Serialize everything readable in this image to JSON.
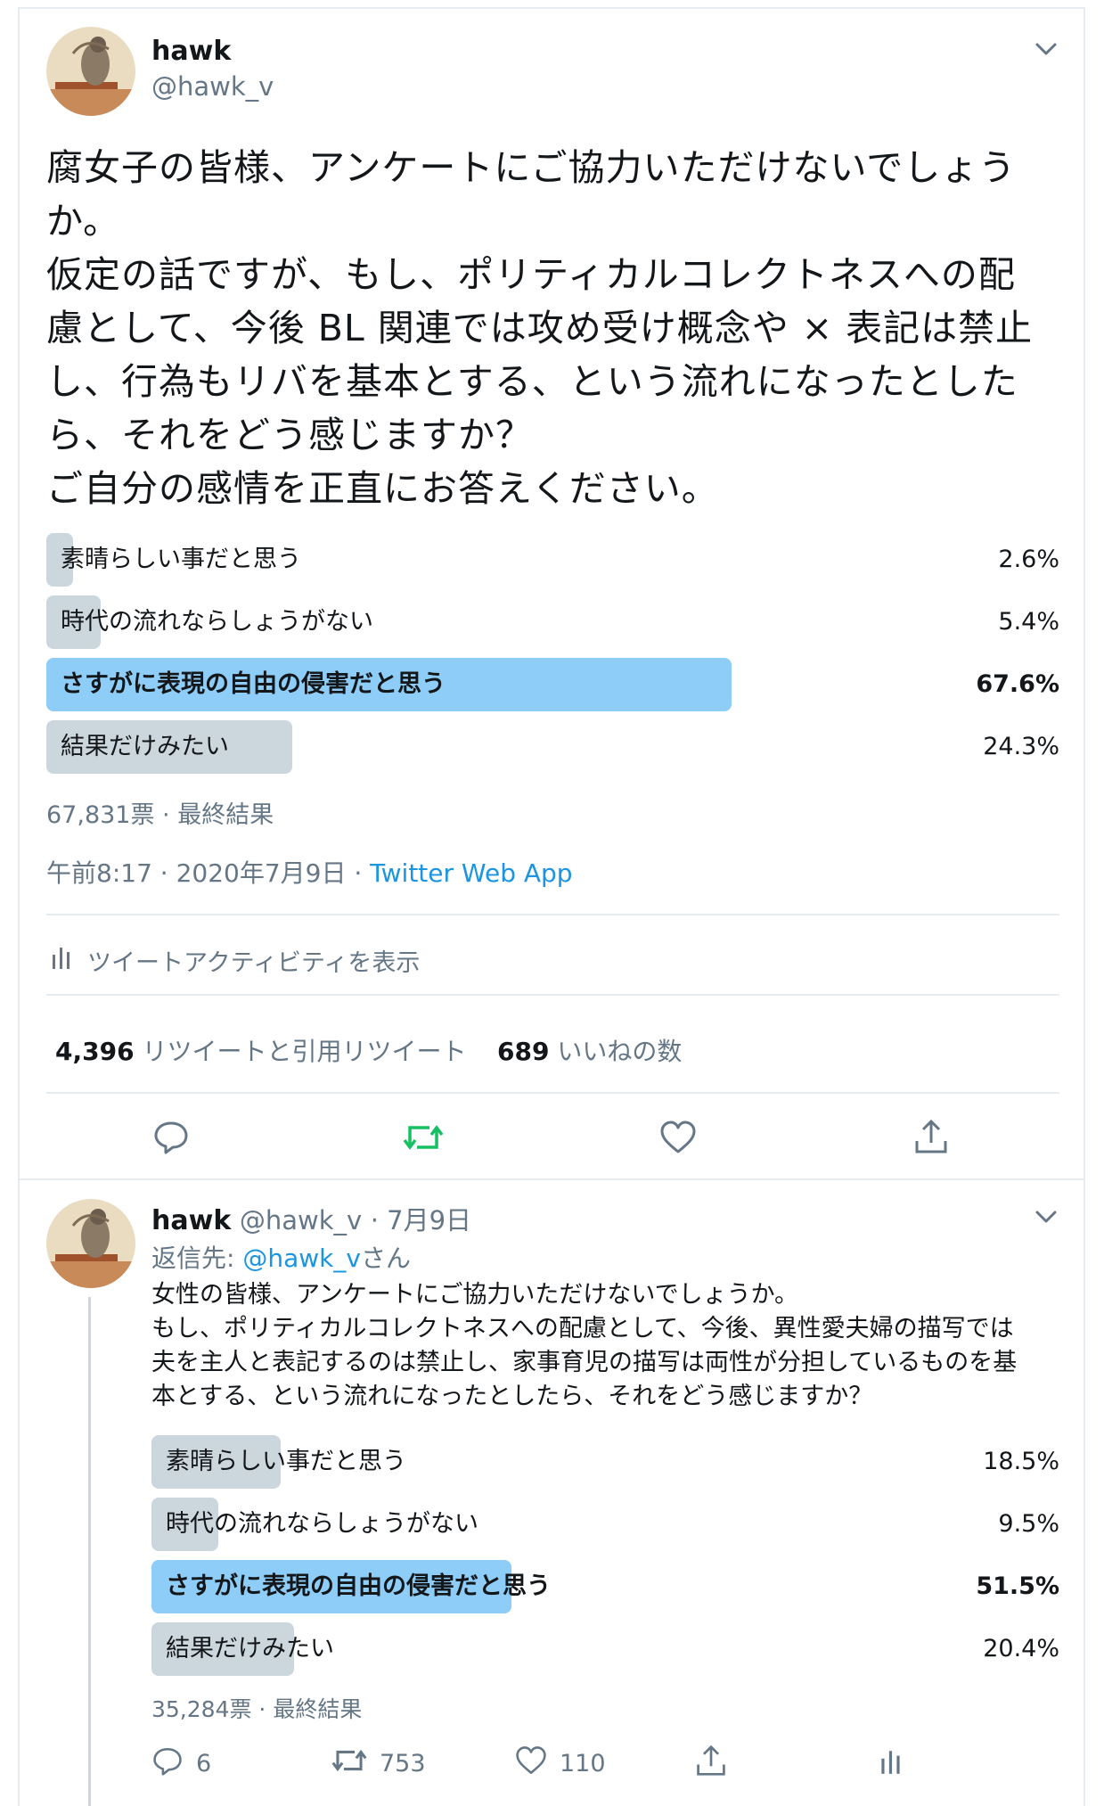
{
  "main_tweet": {
    "author_name": "hawk",
    "author_handle": "@hawk_v",
    "text": "腐女子の皆様、アンケートにご協力いただけないでしょう\nか。\n仮定の話ですが、もし、ポリティカルコレクトネスへの配\n慮として、今後 BL 関連では攻め受け概念や × 表記は禁止\nし、行為もリバを基本とする、という流れになったとした\nら、それをどう感じますか？\nご自分の感情を正直にお答えください。",
    "poll": {
      "options": [
        {
          "label": "素晴らしい事だと思う",
          "percent": "2.6%",
          "value": 2.6,
          "winner": false
        },
        {
          "label": "時代の流れならしょうがない",
          "percent": "5.4%",
          "value": 5.4,
          "winner": false
        },
        {
          "label": "さすがに表現の自由の侵害だと思う",
          "percent": "67.6%",
          "value": 67.6,
          "winner": true
        },
        {
          "label": "結果だけみたい",
          "percent": "24.3%",
          "value": 24.3,
          "winner": false
        }
      ],
      "footer": "67,831票 · 最終結果"
    },
    "timestamp": "午前8:17 · 2020年7月9日 · ",
    "source": "Twitter Web App",
    "activity_label": "ツイートアクティビティを表示",
    "retweets_count": "4,396",
    "retweets_label": "リツイートと引用リツイート",
    "likes_count": "689",
    "likes_label": "いいねの数"
  },
  "reply_tweet": {
    "author_name": "hawk",
    "author_handle": "@hawk_v",
    "date": "· 7月9日",
    "reply_to_prefix": "返信先: ",
    "reply_to_handle": "@hawk_v",
    "reply_to_suffix": "さん",
    "text": "女性の皆様、アンケートにご協力いただけないでしょうか。\nもし、ポリティカルコレクトネスへの配慮として、今後、異性愛夫婦の描写では\n夫を主人と表記するのは禁止し、家事育児の描写は両性が分担しているものを基\n本とする、という流れになったとしたら、それをどう感じますか？",
    "poll": {
      "options": [
        {
          "label": "素晴らしい事だと思う",
          "percent": "18.5%",
          "value": 18.5,
          "winner": false
        },
        {
          "label": "時代の流れならしょうがない",
          "percent": "9.5%",
          "value": 9.5,
          "winner": false
        },
        {
          "label": "さすがに表現の自由の侵害だと思う",
          "percent": "51.5%",
          "value": 51.5,
          "winner": true
        },
        {
          "label": "結果だけみたい",
          "percent": "20.4%",
          "value": 20.4,
          "winner": false
        }
      ],
      "footer": "35,284票 · 最終結果"
    },
    "reply_count": "6",
    "retweet_count": "753",
    "like_count": "110"
  },
  "colors": {
    "winner_bar": "#8ecdf7",
    "other_bar": "#ccd6dd",
    "retweet_green": "#17bf63",
    "link_blue": "#1b95e0",
    "gray_text": "#657786"
  }
}
